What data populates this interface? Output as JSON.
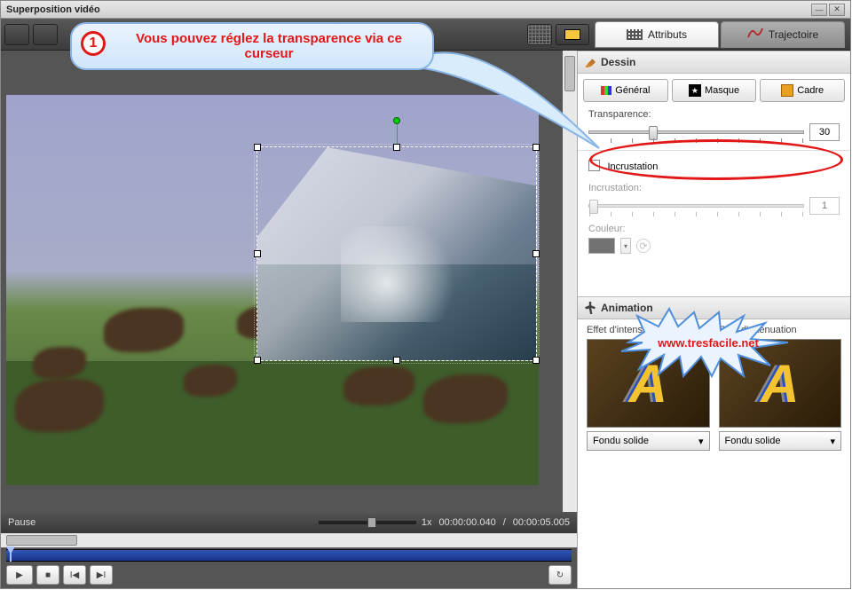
{
  "titlebar": {
    "title": "Superposition vidéo"
  },
  "tabs": {
    "attributes": "Attributs",
    "trajectory": "Trajectoire"
  },
  "callout": {
    "number": "1",
    "text": "Vous pouvez réglez la transparence via ce curseur"
  },
  "starburst": {
    "text": "www.tresfacile.net"
  },
  "sections": {
    "dessin": {
      "title": "Dessin"
    },
    "animation": {
      "title": "Animation"
    }
  },
  "subtabs": {
    "general": "Général",
    "masque": "Masque",
    "cadre": "Cadre"
  },
  "transparency": {
    "label": "Transparence:",
    "value": "30"
  },
  "incrustation": {
    "checkbox_label": "Incrustation",
    "slider_label": "Incrustation:",
    "value": "1",
    "color_label": "Couleur:"
  },
  "animation": {
    "intensification": {
      "label": "Effet d'intensification",
      "preset": "Fondu solide"
    },
    "attenuation": {
      "label": "Effet d'atténuation",
      "preset": "Fondu solide"
    }
  },
  "playback": {
    "status": "Pause",
    "speed": "1x",
    "current": "00:00:00.040",
    "total": "00:00:05.005",
    "separator": "/"
  }
}
